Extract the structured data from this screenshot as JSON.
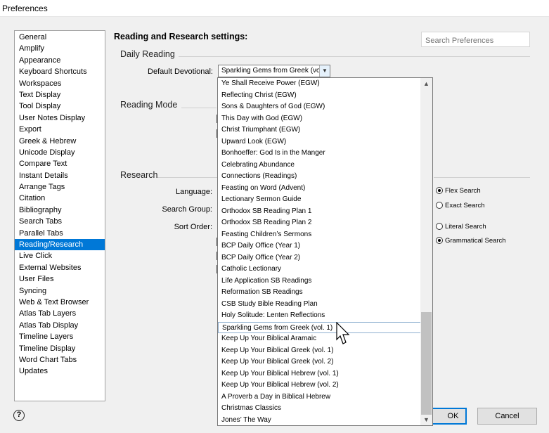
{
  "window": {
    "title": "Preferences"
  },
  "sidebar": {
    "items": [
      {
        "label": "General"
      },
      {
        "label": "Amplify"
      },
      {
        "label": "Appearance"
      },
      {
        "label": "Keyboard Shortcuts"
      },
      {
        "label": "Workspaces"
      },
      {
        "label": "Text Display"
      },
      {
        "label": "Tool Display"
      },
      {
        "label": "User Notes Display"
      },
      {
        "label": "Export"
      },
      {
        "label": "Greek & Hebrew"
      },
      {
        "label": "Unicode Display"
      },
      {
        "label": "Compare Text"
      },
      {
        "label": "Instant Details"
      },
      {
        "label": "Arrange Tags"
      },
      {
        "label": "Citation"
      },
      {
        "label": "Bibliography"
      },
      {
        "label": "Search Tabs"
      },
      {
        "label": "Parallel Tabs"
      },
      {
        "label": "Reading/Research",
        "selected": true
      },
      {
        "label": "Live Click"
      },
      {
        "label": "External Websites"
      },
      {
        "label": "User Files"
      },
      {
        "label": "Syncing"
      },
      {
        "label": "Web & Text Browser"
      },
      {
        "label": "Atlas Tab Layers"
      },
      {
        "label": "Atlas Tab Display"
      },
      {
        "label": "Timeline Layers"
      },
      {
        "label": "Timeline Display"
      },
      {
        "label": "Word Chart Tabs"
      },
      {
        "label": "Updates"
      }
    ]
  },
  "main": {
    "title": "Reading and Research settings:",
    "search": {
      "placeholder": "Search Preferences"
    },
    "groups": {
      "daily_reading": "Daily Reading",
      "reading_mode": "Reading Mode",
      "research": "Research"
    },
    "fields": {
      "default_devotional": {
        "label": "Default Devotional:",
        "value": "Sparkling Gems from Greek (vo"
      },
      "language": {
        "label": "Language:"
      },
      "search_group": {
        "label": "Search Group:"
      },
      "sort_order": {
        "label": "Sort Order:"
      }
    },
    "radios": {
      "flex_search": {
        "label": "Flex Search",
        "checked": true
      },
      "exact_search": {
        "label": "Exact Search",
        "checked": false
      },
      "literal_search": {
        "label": "Literal Search",
        "checked": false
      },
      "grammatical_search": {
        "label": "Grammatical Search",
        "checked": true
      }
    }
  },
  "dropdown": {
    "items": [
      {
        "label": "Ye Shall Receive Power (EGW)"
      },
      {
        "label": "Reflecting Christ (EGW)"
      },
      {
        "label": "Sons & Daughters of God (EGW)"
      },
      {
        "label": "This Day with God (EGW)"
      },
      {
        "label": "Christ Triumphant (EGW)"
      },
      {
        "label": "Upward Look (EGW)"
      },
      {
        "label": "Bonhoeffer: God Is in the Manger"
      },
      {
        "label": "Celebrating Abundance"
      },
      {
        "label": "Connections (Readings)"
      },
      {
        "label": "Feasting on Word (Advent)"
      },
      {
        "label": "Lectionary Sermon Guide"
      },
      {
        "label": "Orthodox SB Reading Plan 1"
      },
      {
        "label": "Orthodox SB Reading Plan 2"
      },
      {
        "label": "Feasting Children’s Sermons"
      },
      {
        "label": "BCP Daily Office (Year 1)"
      },
      {
        "label": "BCP Daily Office (Year 2)"
      },
      {
        "label": "Catholic Lectionary"
      },
      {
        "label": "Life Application SB Readings"
      },
      {
        "label": "Reformation SB Readings"
      },
      {
        "label": "CSB Study Bible Reading Plan"
      },
      {
        "label": "Holy Solitude: Lenten Reflections"
      },
      {
        "label": "Sparkling Gems from Greek (vol. 1)",
        "selected": true
      },
      {
        "label": "Keep Up Your Biblical Aramaic"
      },
      {
        "label": "Keep Up Your Biblical Greek (vol. 1)"
      },
      {
        "label": "Keep Up Your Biblical Greek (vol. 2)"
      },
      {
        "label": "Keep Up Your Biblical Hebrew (vol. 1)"
      },
      {
        "label": "Keep Up Your Biblical Hebrew (vol. 2)"
      },
      {
        "label": "A Proverb a Day in Biblical Hebrew"
      },
      {
        "label": "Christmas Classics"
      },
      {
        "label": "Jones’ The Way"
      }
    ]
  },
  "footer": {
    "help": "?",
    "ok_label": "OK",
    "cancel_label": "Cancel"
  },
  "icons": {
    "scroll_up": "chevron-up-icon",
    "scroll_down": "chevron-down-icon",
    "combo": "chevron-down-icon"
  }
}
